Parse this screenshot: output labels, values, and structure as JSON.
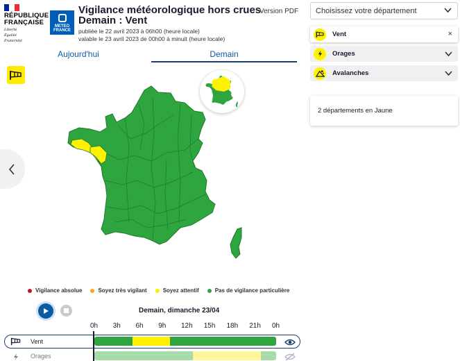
{
  "header": {
    "republic_lines": [
      "RÉPUBLIQUE",
      "FRANÇAISE"
    ],
    "republic_motto": [
      "Liberté",
      "Égalité",
      "Fraternité"
    ],
    "meteo_logo_text": [
      "METEO",
      "FRANCE"
    ],
    "title_line1": "Vigilance météorologique hors crues",
    "title_line2": "Demain : Vent",
    "published": "publiée le 22 avril 2023 à 06h00 (heure locale)",
    "valid": "valable le 23 avril 2023 de 00h00 à minuit (heure locale)",
    "pdf_label": "Version PDF"
  },
  "tabs": [
    {
      "label": "Aujourd'hui",
      "active": false
    },
    {
      "label": "Demain",
      "active": true
    }
  ],
  "map": {
    "active_phenomenon_icon": "wind-icon",
    "colors": {
      "green": "#2ea53e",
      "yellow": "#fff200",
      "orange": "#f5a623",
      "red": "#c8102e",
      "border": "#1e7a2c"
    }
  },
  "legend": [
    {
      "label": "Vigilance absolue",
      "color": "#c8102e"
    },
    {
      "label": "Soyez très vigilant",
      "color": "#f5a623"
    },
    {
      "label": "Soyez attentif",
      "color": "#fff200"
    },
    {
      "label": "Pas de vigilance particulière",
      "color": "#2ea53e"
    }
  ],
  "timeline": {
    "day_label": "Demain, dimanche 23/04",
    "hours": [
      "0h",
      "3h",
      "6h",
      "9h",
      "12h",
      "15h",
      "18h",
      "21h",
      "0h"
    ],
    "rows": [
      {
        "label": "Vent",
        "icon": "wind-icon",
        "segments": [
          {
            "from_hour": 0,
            "to_hour": 5,
            "color": "#2ea53e"
          },
          {
            "from_hour": 5,
            "to_hour": 10,
            "color": "#fff200"
          },
          {
            "from_hour": 10,
            "to_hour": 24,
            "color": "#2ea53e"
          }
        ]
      },
      {
        "label": "Orages",
        "icon": "lightning-icon",
        "segments": [
          {
            "from_hour": 0,
            "to_hour": 13,
            "color": "#a7dba7"
          },
          {
            "from_hour": 13,
            "to_hour": 22,
            "color": "#fff59a"
          },
          {
            "from_hour": 22,
            "to_hour": 24,
            "color": "#a7dba7"
          }
        ]
      }
    ]
  },
  "department_select": {
    "placeholder": "Choisissez votre département"
  },
  "phenomena": [
    {
      "label": "Vent",
      "icon": "wind-icon",
      "selected": true
    },
    {
      "label": "Orages",
      "icon": "lightning-icon",
      "selected": false
    },
    {
      "label": "Avalanches",
      "icon": "avalanche-icon",
      "selected": false
    }
  ],
  "summary": {
    "text": "2 départements en Jaune"
  },
  "glyphs": {
    "close": "×"
  }
}
